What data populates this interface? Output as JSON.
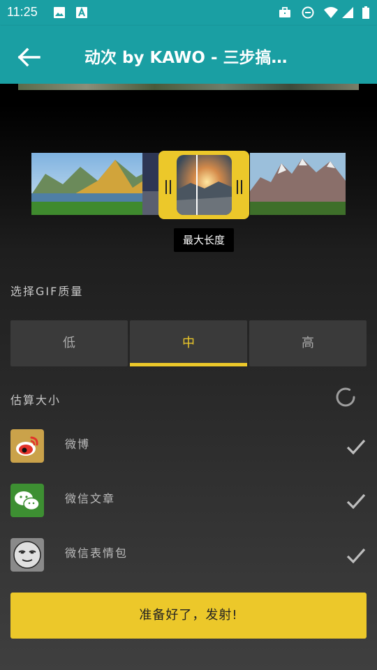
{
  "status_bar": {
    "time": "11:25",
    "icons": [
      "image-icon",
      "a-box-icon",
      "briefcase-icon",
      "do-not-disturb-icon",
      "wifi-icon",
      "signal-icon",
      "battery-icon"
    ]
  },
  "app_bar": {
    "title": "动次 by KAWO - 三步搞…",
    "back_icon": "arrow-back-icon",
    "color": "#1a9fa3"
  },
  "trimmer": {
    "tooltip": "最大长度",
    "accent": "#ecc82a"
  },
  "quality": {
    "label": "选择GIF质量",
    "options": [
      "低",
      "中",
      "高"
    ],
    "selected": "中"
  },
  "estimate": {
    "label": "估算大小"
  },
  "targets": [
    {
      "label": "微博",
      "icon": "weibo-icon",
      "checked": true
    },
    {
      "label": "微信文章",
      "icon": "wechat-icon",
      "checked": true
    },
    {
      "label": "微信表情包",
      "icon": "sticker-face-icon",
      "checked": true
    }
  ],
  "launch_button": {
    "label": "准备好了，发射!"
  }
}
